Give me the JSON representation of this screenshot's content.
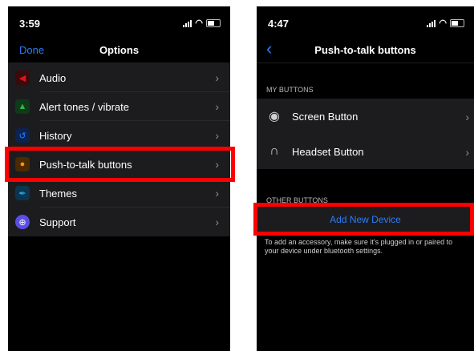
{
  "left": {
    "status": {
      "time": "3:59"
    },
    "nav": {
      "done": "Done",
      "title": "Options"
    },
    "items": [
      {
        "label": "Audio",
        "icon": "speaker-icon",
        "color": "#e0141c"
      },
      {
        "label": "Alert tones / vibrate",
        "icon": "bell-icon",
        "color": "#2db84b"
      },
      {
        "label": "History",
        "icon": "history-icon",
        "color": "#2e7cf6"
      },
      {
        "label": "Push-to-talk buttons",
        "icon": "microphone-icon",
        "color": "#ff9500"
      },
      {
        "label": "Themes",
        "icon": "brush-icon",
        "color": "#27a7e0"
      },
      {
        "label": "Support",
        "icon": "lifebuoy-icon",
        "color": "#5a4ee8"
      }
    ]
  },
  "right": {
    "status": {
      "time": "4:47"
    },
    "nav": {
      "title": "Push-to-talk buttons"
    },
    "my_buttons": {
      "header": "MY BUTTONS",
      "items": [
        {
          "label": "Screen Button",
          "icon": "screen-button-icon"
        },
        {
          "label": "Headset Button",
          "icon": "headset-icon"
        }
      ]
    },
    "other_buttons": {
      "header": "OTHER BUTTONS",
      "add_label": "Add New Device",
      "footnote": "To add an accessory, make sure it's plugged in or paired to your device under bluetooth settings."
    }
  },
  "colors": {
    "accent": "#2e7cf6",
    "highlight": "#ff0000"
  }
}
